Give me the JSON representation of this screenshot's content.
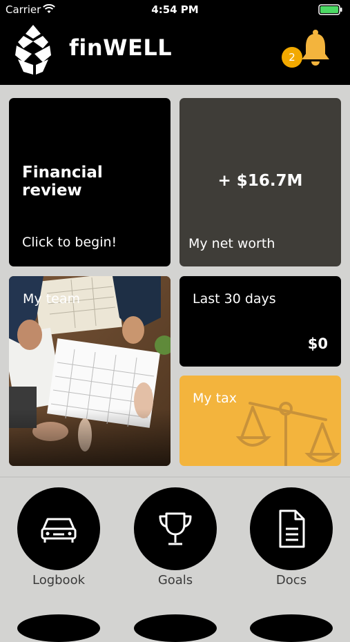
{
  "status_bar": {
    "carrier": "Carrier",
    "time": "4:54 PM"
  },
  "header": {
    "app_name": "finWELL",
    "notification_count": "2"
  },
  "tiles": {
    "review": {
      "title": "Financial review",
      "subtitle": "Click to begin!"
    },
    "net_worth": {
      "amount": "+ $16.7M",
      "label": "My net worth"
    },
    "team": {
      "label": "My team"
    },
    "last30": {
      "label": "Last 30 days",
      "value": "$0"
    },
    "tax": {
      "label": "My tax"
    }
  },
  "nav": [
    {
      "label": "Logbook",
      "icon": "car-icon"
    },
    {
      "label": "Goals",
      "icon": "trophy-icon"
    },
    {
      "label": "Docs",
      "icon": "document-icon"
    }
  ],
  "colors": {
    "accent": "#f3b43d",
    "badge": "#f2a900",
    "dark_tile": "#3f3d38",
    "background": "#d3d3d1"
  }
}
